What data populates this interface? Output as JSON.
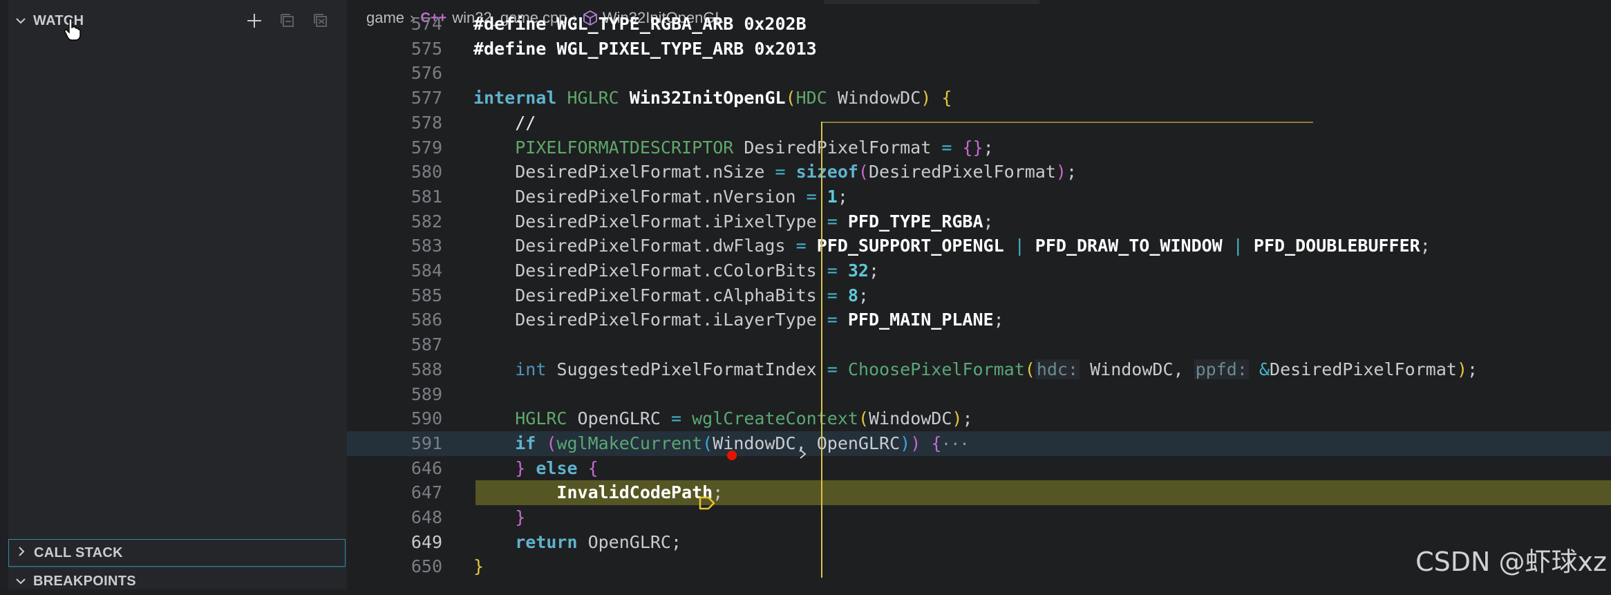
{
  "sidebar": {
    "watch": {
      "title": "WATCH",
      "actions": [
        "add-expression-icon",
        "collapse-all-icon",
        "remove-all-icon"
      ]
    },
    "call_stack": {
      "title": "CALL STACK"
    },
    "breakpoints": {
      "title": "BREAKPOINTS"
    }
  },
  "breadcrumb": {
    "folder": "game",
    "file": "win32_game.cpp",
    "file_icon": "C++",
    "symbol": "Win32InitOpenGL"
  },
  "editor": {
    "lines": [
      {
        "n": "574",
        "tokens": [
          [
            "mac",
            "#define WGL_TYPE_RGBA_ARB 0x202B"
          ]
        ]
      },
      {
        "n": "575",
        "tokens": [
          [
            "mac",
            "#define WGL_PIXEL_TYPE_ARB 0x2013"
          ]
        ]
      },
      {
        "n": "576",
        "tokens": []
      },
      {
        "n": "577",
        "tokens": [
          [
            "kw",
            "internal "
          ],
          [
            "ty",
            "HGLRC "
          ],
          [
            "fn",
            "Win32InitOpenGL"
          ],
          [
            "p1",
            "("
          ],
          [
            "ty",
            "HDC "
          ],
          [
            "pu",
            "WindowDC"
          ],
          [
            "p1",
            ")"
          ],
          [
            "pu",
            " "
          ],
          [
            "p1",
            "{"
          ]
        ]
      },
      {
        "n": "578",
        "tokens": [
          [
            "pu",
            "    "
          ],
          [
            "cm",
            "//"
          ]
        ]
      },
      {
        "n": "579",
        "tokens": [
          [
            "pu",
            "    "
          ],
          [
            "ty",
            "PIXELFORMATDESCRIPTOR "
          ],
          [
            "pu",
            "DesiredPixelFormat "
          ],
          [
            "op",
            "= "
          ],
          [
            "p2",
            "{}"
          ],
          [
            "pu",
            ";"
          ]
        ]
      },
      {
        "n": "580",
        "tokens": [
          [
            "pu",
            "    DesiredPixelFormat.nSize "
          ],
          [
            "op",
            "= "
          ],
          [
            "kw",
            "sizeof"
          ],
          [
            "p2",
            "("
          ],
          [
            "pu",
            "DesiredPixelFormat"
          ],
          [
            "p2",
            ")"
          ],
          [
            "pu",
            ";"
          ]
        ]
      },
      {
        "n": "581",
        "tokens": [
          [
            "pu",
            "    DesiredPixelFormat.nVersion "
          ],
          [
            "op",
            "= "
          ],
          [
            "num",
            "1"
          ],
          [
            "pu",
            ";"
          ]
        ]
      },
      {
        "n": "582",
        "tokens": [
          [
            "pu",
            "    DesiredPixelFormat.iPixelType "
          ],
          [
            "op",
            "= "
          ],
          [
            "mac",
            "PFD_TYPE_RGBA"
          ],
          [
            "pu",
            ";"
          ]
        ]
      },
      {
        "n": "583",
        "tokens": [
          [
            "pu",
            "    DesiredPixelFormat.dwFlags "
          ],
          [
            "op",
            "= "
          ],
          [
            "mac",
            "PFD_SUPPORT_OPENGL "
          ],
          [
            "op",
            "| "
          ],
          [
            "mac",
            "PFD_DRAW_TO_WINDOW "
          ],
          [
            "op",
            "| "
          ],
          [
            "mac",
            "PFD_DOUBLEBUFFER"
          ],
          [
            "pu",
            ";"
          ]
        ]
      },
      {
        "n": "584",
        "tokens": [
          [
            "pu",
            "    DesiredPixelFormat.cColorBits "
          ],
          [
            "op",
            "= "
          ],
          [
            "num",
            "32"
          ],
          [
            "pu",
            ";"
          ]
        ]
      },
      {
        "n": "585",
        "tokens": [
          [
            "pu",
            "    DesiredPixelFormat.cAlphaBits "
          ],
          [
            "op",
            "= "
          ],
          [
            "num",
            "8"
          ],
          [
            "pu",
            ";"
          ]
        ]
      },
      {
        "n": "586",
        "tokens": [
          [
            "pu",
            "    DesiredPixelFormat.iLayerType "
          ],
          [
            "op",
            "= "
          ],
          [
            "mac",
            "PFD_MAIN_PLANE"
          ],
          [
            "pu",
            ";"
          ]
        ]
      },
      {
        "n": "587",
        "tokens": []
      },
      {
        "n": "588",
        "tokens": [
          [
            "pu",
            "    "
          ],
          [
            "kw2",
            "int "
          ],
          [
            "pu",
            "SuggestedPixelFormatIndex "
          ],
          [
            "op",
            "= "
          ],
          [
            "fn2",
            "ChoosePixelFormat"
          ],
          [
            "p1",
            "("
          ],
          [
            "hint",
            "hdc:"
          ],
          [
            "pu",
            " WindowDC, "
          ],
          [
            "hint",
            "ppfd:"
          ],
          [
            "pu",
            " "
          ],
          [
            "op",
            "&"
          ],
          [
            "pu",
            "DesiredPixelFormat"
          ],
          [
            "p1",
            ")"
          ],
          [
            "pu",
            ";"
          ]
        ]
      },
      {
        "n": "589",
        "tokens": []
      },
      {
        "n": "590",
        "tokens": [
          [
            "pu",
            "    "
          ],
          [
            "ty",
            "HGLRC "
          ],
          [
            "pu",
            "OpenGLRC "
          ],
          [
            "op",
            "= "
          ],
          [
            "fn2",
            "wglCreateContext"
          ],
          [
            "p1",
            "("
          ],
          [
            "pu",
            "WindowDC"
          ],
          [
            "p1",
            ")"
          ],
          [
            "pu",
            ";"
          ]
        ]
      },
      {
        "n": "591",
        "tokens": [
          [
            "pu",
            "    "
          ],
          [
            "kw",
            "if "
          ],
          [
            "p2",
            "("
          ],
          [
            "fn2",
            "wglMakeCurrent"
          ],
          [
            "p3",
            "("
          ],
          [
            "pu",
            "WindowDC, OpenGLRC"
          ],
          [
            "p3",
            ")"
          ],
          [
            "p2",
            ")"
          ],
          [
            "pu",
            " "
          ],
          [
            "p2",
            "{"
          ],
          [
            "fold-dots",
            "···"
          ]
        ]
      },
      {
        "n": "646",
        "tokens": [
          [
            "pu",
            "    "
          ],
          [
            "p2",
            "}"
          ],
          [
            "pu",
            " "
          ],
          [
            "kw",
            "else "
          ],
          [
            "p2",
            "{"
          ]
        ]
      },
      {
        "n": "647",
        "tokens": [
          [
            "pu",
            "        "
          ],
          [
            "mac",
            "InvalidCodePath"
          ],
          [
            "pu",
            ";"
          ]
        ]
      },
      {
        "n": "648",
        "tokens": [
          [
            "pu",
            "    "
          ],
          [
            "p2",
            "}"
          ]
        ]
      },
      {
        "n": "649",
        "tokens": [
          [
            "pu",
            "    "
          ],
          [
            "kw",
            "return "
          ],
          [
            "pu",
            "OpenGLRC;"
          ]
        ]
      },
      {
        "n": "650",
        "tokens": [
          [
            "p1",
            "}"
          ]
        ]
      }
    ]
  },
  "watermark": "CSDN @虾球xz",
  "colors": {
    "breakpoint": "#e51400",
    "exec_highlight": "#565624",
    "scope_guide": "#d9c34a"
  }
}
